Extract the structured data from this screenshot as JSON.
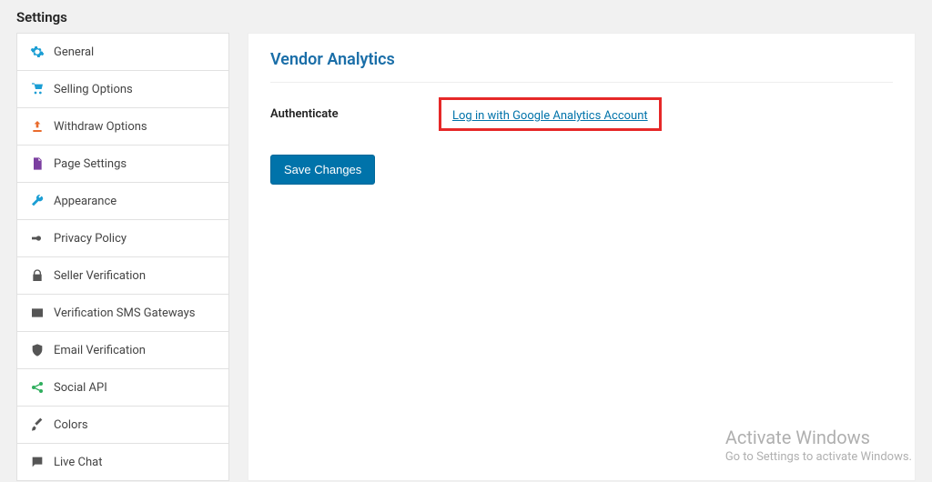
{
  "page_title": "Settings",
  "sidebar": {
    "items": [
      {
        "label": "General",
        "icon": "gear",
        "color": "#1b9ed4"
      },
      {
        "label": "Selling Options",
        "icon": "cart",
        "color": "#1b9ed4"
      },
      {
        "label": "Withdraw Options",
        "icon": "upload",
        "color": "#e96b2c"
      },
      {
        "label": "Page Settings",
        "icon": "page",
        "color": "#7b3fa0"
      },
      {
        "label": "Appearance",
        "icon": "wrench",
        "color": "#1b9ed4"
      },
      {
        "label": "Privacy Policy",
        "icon": "key",
        "color": "#555"
      },
      {
        "label": "Seller Verification",
        "icon": "lock",
        "color": "#555"
      },
      {
        "label": "Verification SMS Gateways",
        "icon": "mail",
        "color": "#555"
      },
      {
        "label": "Email Verification",
        "icon": "shield",
        "color": "#555"
      },
      {
        "label": "Social API",
        "icon": "share",
        "color": "#2fae5d"
      },
      {
        "label": "Colors",
        "icon": "brush",
        "color": "#555"
      },
      {
        "label": "Live Chat",
        "icon": "chat",
        "color": "#555"
      }
    ]
  },
  "main": {
    "section_title": "Vendor Analytics",
    "auth_label": "Authenticate",
    "auth_link_text": "Log in with Google Analytics Account",
    "save_button": "Save Changes"
  },
  "watermark": {
    "title": "Activate Windows",
    "sub": "Go to Settings to activate Windows."
  }
}
